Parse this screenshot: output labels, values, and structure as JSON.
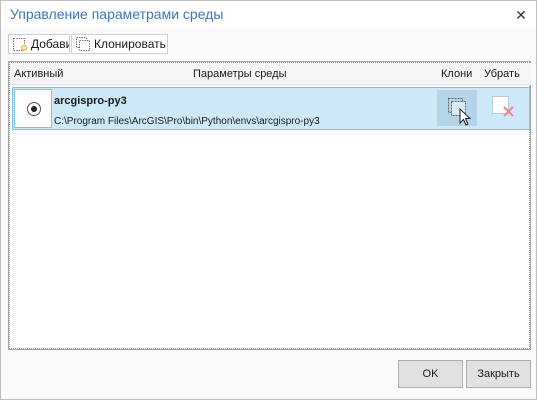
{
  "window": {
    "title": "Управление параметрами среды",
    "close_glyph": "✕"
  },
  "toolbar": {
    "add_label": "Добави",
    "clone_label": "Клонировать г"
  },
  "table": {
    "columns": [
      "Активный",
      "Параметры среды",
      "Клони",
      "Убрать"
    ],
    "rows": [
      {
        "active": true,
        "name": "arcgispro-py3",
        "path": "C:\\Program Files\\ArcGIS\\Pro\\bin\\Python\\envs\\arcgispro-py3"
      }
    ]
  },
  "buttons": {
    "ok": "OK",
    "close": "Закрыть"
  },
  "colors": {
    "title": "#3b77b6",
    "row_selected_bg": "#cde8f7",
    "row_selected_border": "#7fc2e9",
    "remove_icon": "#e08a8a"
  },
  "icons": {
    "add": "add-environment-icon",
    "clone": "clone-environment-icon",
    "row_clone": "clone-row-icon",
    "row_remove": "remove-row-icon",
    "cursor": "mouse-cursor-icon"
  }
}
